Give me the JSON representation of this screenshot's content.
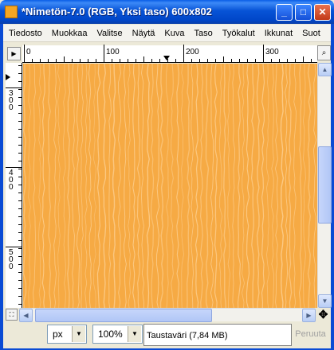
{
  "window": {
    "title": "*Nimetön-7.0 (RGB, Yksi taso) 600x802",
    "controls": {
      "minimize": "_",
      "maximize": "□",
      "close": "✕"
    }
  },
  "menubar": {
    "items": [
      {
        "label": "Tiedosto"
      },
      {
        "label": "Muokkaa"
      },
      {
        "label": "Valitse"
      },
      {
        "label": "Näytä"
      },
      {
        "label": "Kuva"
      },
      {
        "label": "Taso"
      },
      {
        "label": "Työkalut"
      },
      {
        "label": "Ikkunat"
      },
      {
        "label": "Suot"
      }
    ]
  },
  "rulers": {
    "horizontal_labels": [
      "0",
      "100",
      "200",
      "300"
    ],
    "vertical_labels": [
      "300",
      "400",
      "500"
    ]
  },
  "canvas": {
    "fill_color": "#f6aa44",
    "pattern_color": "#fccc8a",
    "pattern": "vertical wood grain"
  },
  "statusbar": {
    "unit": "px",
    "zoom": "100%",
    "status_text": "Taustaväri (7,84 MB)",
    "cancel_label": "Peruuta"
  },
  "icons": {
    "app": "gimp-image-icon",
    "menu_toggle": "triangle-right-icon",
    "zoom_toggle": "magnifier-icon",
    "navigate": "navigate-icon",
    "move": "move-cross-icon"
  }
}
